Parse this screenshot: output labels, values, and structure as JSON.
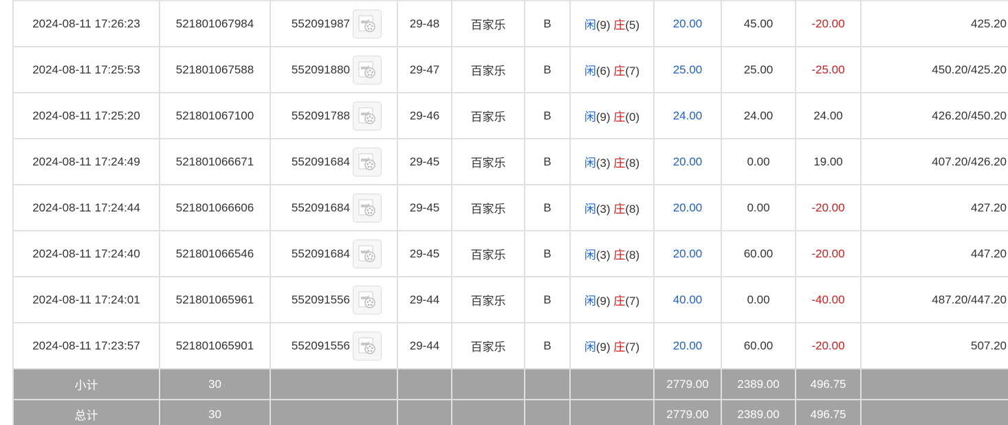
{
  "colors": {
    "blue": "#1d5fd6",
    "red": "#d31a1a",
    "summary_bg": "#a3a3a3",
    "border": "#e0e0e0"
  },
  "icons": {
    "video": "video-replay-icon"
  },
  "rows": [
    {
      "time": "2024-08-11 17:26:23",
      "bet_id": "521801067984",
      "round": "552091987",
      "shoe": "29-48",
      "game": "百家乐",
      "table": "B",
      "player_label": "闲",
      "player_score": "(9)",
      "banker_label": "庄",
      "banker_score": "(5)",
      "bet": "20.00",
      "valid_bet": "45.00",
      "win_loss": "-20.00",
      "balance": "425.20"
    },
    {
      "time": "2024-08-11 17:25:53",
      "bet_id": "521801067588",
      "round": "552091880",
      "shoe": "29-47",
      "game": "百家乐",
      "table": "B",
      "player_label": "闲",
      "player_score": "(6)",
      "banker_label": "庄",
      "banker_score": "(7)",
      "bet": "25.00",
      "valid_bet": "25.00",
      "win_loss": "-25.00",
      "balance": "450.20/425.20"
    },
    {
      "time": "2024-08-11 17:25:20",
      "bet_id": "521801067100",
      "round": "552091788",
      "shoe": "29-46",
      "game": "百家乐",
      "table": "B",
      "player_label": "闲",
      "player_score": "(9)",
      "banker_label": "庄",
      "banker_score": "(0)",
      "bet": "24.00",
      "valid_bet": "24.00",
      "win_loss": "24.00",
      "balance": "426.20/450.20"
    },
    {
      "time": "2024-08-11 17:24:49",
      "bet_id": "521801066671",
      "round": "552091684",
      "shoe": "29-45",
      "game": "百家乐",
      "table": "B",
      "player_label": "闲",
      "player_score": "(3)",
      "banker_label": "庄",
      "banker_score": "(8)",
      "bet": "20.00",
      "valid_bet": "0.00",
      "win_loss": "19.00",
      "balance": "407.20/426.20"
    },
    {
      "time": "2024-08-11 17:24:44",
      "bet_id": "521801066606",
      "round": "552091684",
      "shoe": "29-45",
      "game": "百家乐",
      "table": "B",
      "player_label": "闲",
      "player_score": "(3)",
      "banker_label": "庄",
      "banker_score": "(8)",
      "bet": "20.00",
      "valid_bet": "0.00",
      "win_loss": "-20.00",
      "balance": "427.20"
    },
    {
      "time": "2024-08-11 17:24:40",
      "bet_id": "521801066546",
      "round": "552091684",
      "shoe": "29-45",
      "game": "百家乐",
      "table": "B",
      "player_label": "闲",
      "player_score": "(3)",
      "banker_label": "庄",
      "banker_score": "(8)",
      "bet": "20.00",
      "valid_bet": "60.00",
      "win_loss": "-20.00",
      "balance": "447.20"
    },
    {
      "time": "2024-08-11 17:24:01",
      "bet_id": "521801065961",
      "round": "552091556",
      "shoe": "29-44",
      "game": "百家乐",
      "table": "B",
      "player_label": "闲",
      "player_score": "(9)",
      "banker_label": "庄",
      "banker_score": "(7)",
      "bet": "40.00",
      "valid_bet": "0.00",
      "win_loss": "-40.00",
      "balance": "487.20/447.20"
    },
    {
      "time": "2024-08-11 17:23:57",
      "bet_id": "521801065901",
      "round": "552091556",
      "shoe": "29-44",
      "game": "百家乐",
      "table": "B",
      "player_label": "闲",
      "player_score": "(9)",
      "banker_label": "庄",
      "banker_score": "(7)",
      "bet": "20.00",
      "valid_bet": "60.00",
      "win_loss": "-20.00",
      "balance": "507.20"
    }
  ],
  "subtotal": {
    "label": "小计",
    "count": "30",
    "bet": "2779.00",
    "valid_bet": "2389.00",
    "win_loss": "496.75"
  },
  "total": {
    "label": "总计",
    "count": "30",
    "bet": "2779.00",
    "valid_bet": "2389.00",
    "win_loss": "496.75"
  }
}
